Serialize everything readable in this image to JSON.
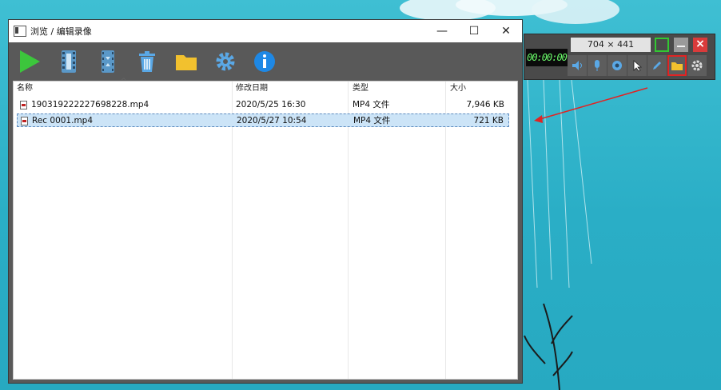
{
  "window": {
    "title": "浏览 / 编辑录像",
    "minimize": "—",
    "maximize": "☐",
    "close": "✕"
  },
  "toolbar": {
    "items": [
      {
        "name": "play-icon"
      },
      {
        "name": "film-edit-icon"
      },
      {
        "name": "film-convert-icon"
      },
      {
        "name": "trash-icon"
      },
      {
        "name": "folder-icon"
      },
      {
        "name": "settings-icon"
      },
      {
        "name": "info-icon"
      }
    ]
  },
  "columns": {
    "name": "名称",
    "modified": "修改日期",
    "type": "类型",
    "size": "大小"
  },
  "files": [
    {
      "name": "190319222227698228.mp4",
      "modified": "2020/5/25 16:30",
      "type": "MP4 文件",
      "size": "7,946 KB",
      "selected": false
    },
    {
      "name": "Rec 0001.mp4",
      "modified": "2020/5/27 10:54",
      "type": "MP4 文件",
      "size": "721 KB",
      "selected": true
    }
  ],
  "recorder": {
    "timer": "00:00:00",
    "dimensions": "704 × 441",
    "tools": [
      "speaker-icon",
      "microphone-icon",
      "webcam-icon",
      "cursor-icon",
      "pen-icon",
      "folder-icon",
      "settings-icon"
    ]
  },
  "colors": {
    "accent_blue": "#1e88e5",
    "play_green": "#3cc63c",
    "folder_yellow": "#f2c12e",
    "highlight_red": "#e02424",
    "selection": "#cce4f7"
  }
}
